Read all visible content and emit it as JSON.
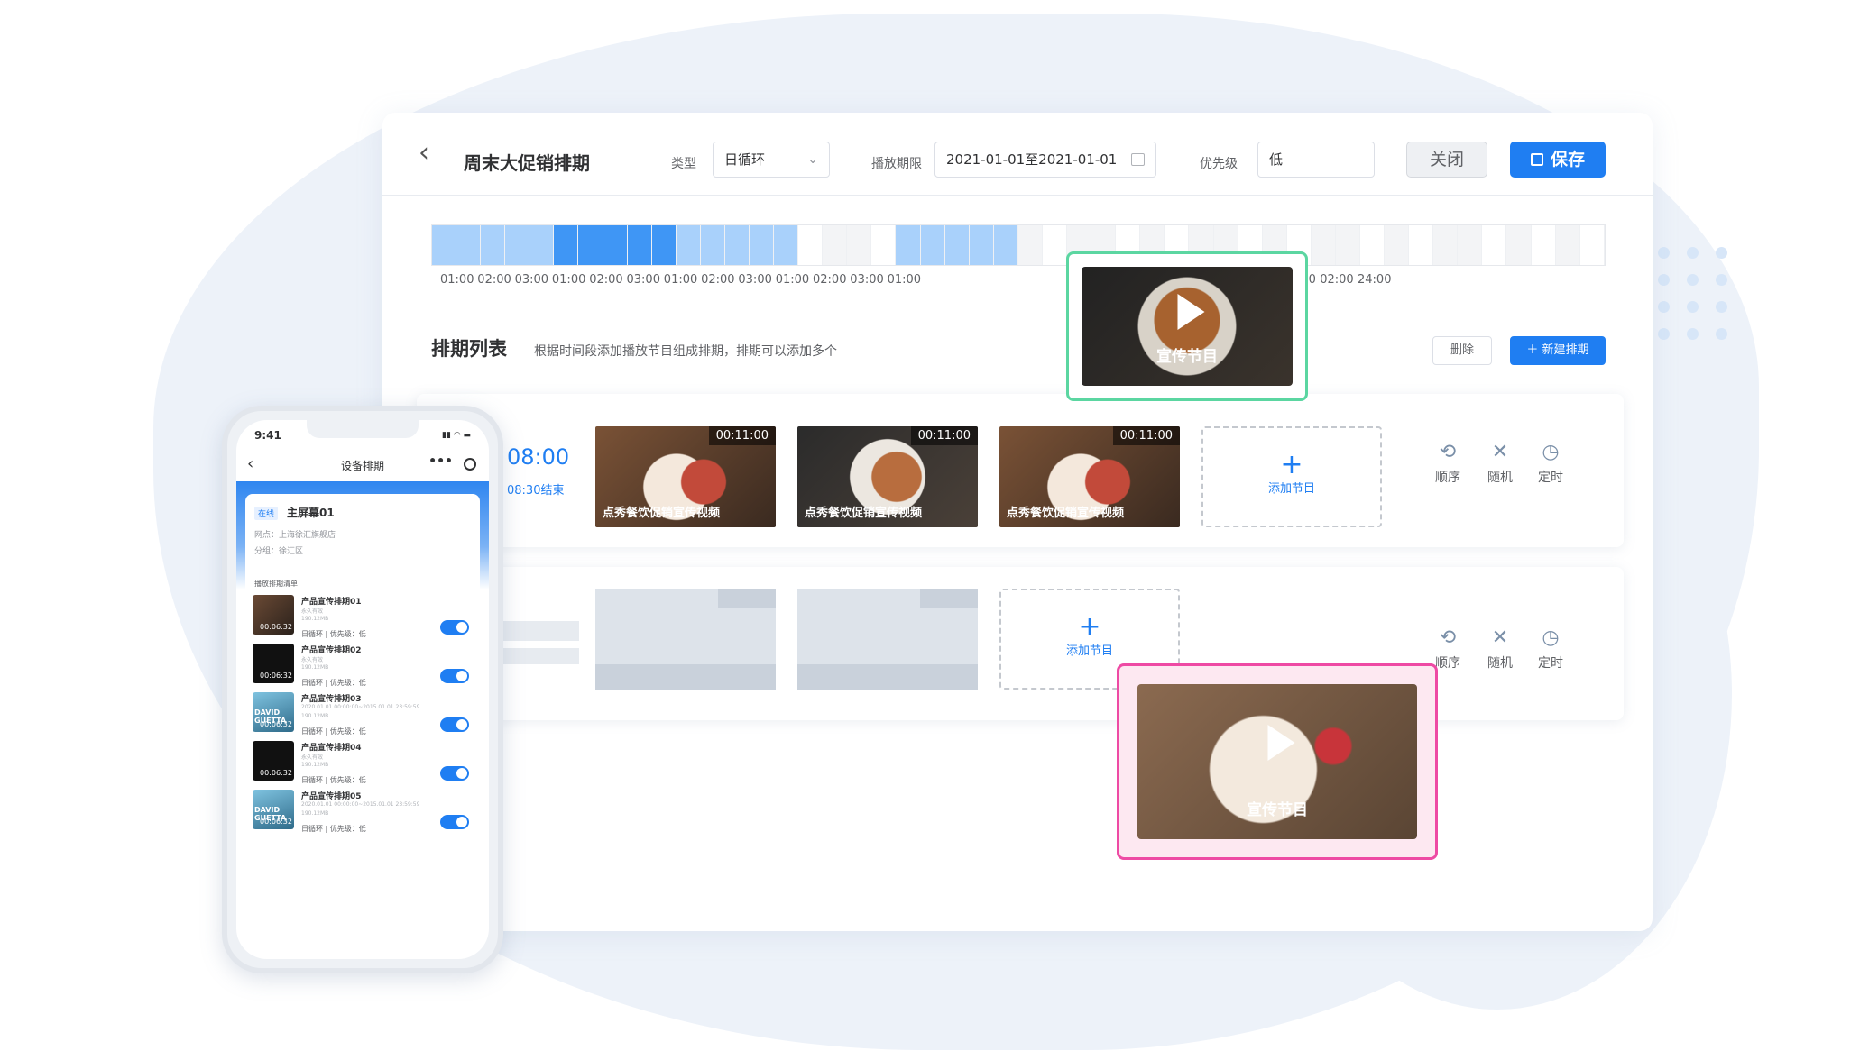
{
  "header": {
    "title": "周末大促销排期",
    "type_label": "类型",
    "type_value": "日循环",
    "period_label": "播放期限",
    "period_value": "2021-01-01至2021-01-01",
    "priority_label": "优先级",
    "priority_value": "低",
    "close_label": "关闭",
    "save_label": "保存"
  },
  "timeline": {
    "ticks": [
      "01:00",
      "02:00",
      "03:00",
      "01:00",
      "02:00",
      "03:00",
      "01:00",
      "02:00",
      "03:00",
      "01:00",
      "02:00",
      "03:00",
      "01:00",
      "01:00",
      "02:00",
      "03:00",
      "01:00",
      "02:00",
      "24:00"
    ],
    "segments": [
      "#a9d1fb",
      "#a9d1fb",
      "#a9d1fb",
      "#a9d1fb",
      "#a9d1fb",
      "#3f96f5",
      "#3f96f5",
      "#3f96f5",
      "#3f96f5",
      "#3f96f5",
      "#a9d1fb",
      "#a9d1fb",
      "#a9d1fb",
      "#a9d1fb",
      "#a9d1fb",
      "#ffffff",
      "#f3f4f6",
      "#f3f4f6",
      "#ffffff",
      "#a9d1fb",
      "#a9d1fb",
      "#a9d1fb",
      "#a9d1fb",
      "#a9d1fb",
      "#f3f4f6",
      "#ffffff",
      "#f3f4f6",
      "#f3f4f6",
      "#ffffff",
      "#f3f4f6",
      "#ffffff",
      "#f3f4f6",
      "#f3f4f6",
      "#ffffff",
      "#f3f4f6",
      "#ffffff",
      "#f3f4f6",
      "#f3f4f6",
      "#ffffff",
      "#f3f4f6",
      "#ffffff",
      "#f3f4f6",
      "#f3f4f6",
      "#ffffff",
      "#f3f4f6",
      "#ffffff",
      "#f3f4f6",
      "#ffffff"
    ]
  },
  "section": {
    "title": "排期列表",
    "description": "根据时间段添加播放节目组成排期，排期可以添加多个",
    "delete_label": "删除",
    "new_label": "＋ 新建排期"
  },
  "schedule1": {
    "start": "08:00",
    "end": "08:30结束",
    "programs": [
      {
        "duration": "00:11:00",
        "caption": "点秀餐饮促销宣传视频"
      },
      {
        "duration": "00:11:00",
        "caption": "点秀餐饮促销宣传视频"
      },
      {
        "duration": "00:11:00",
        "caption": "点秀餐饮促销宣传视频"
      }
    ],
    "add_label": "添加节目"
  },
  "schedule2": {
    "add_label": "添加节目"
  },
  "modes": {
    "order": "顺序",
    "random": "随机",
    "timed": "定时"
  },
  "popups": {
    "caption": "宣传节目"
  },
  "phone": {
    "time": "9:41",
    "nav_title": "设备排期",
    "badge": "在线",
    "device_name": "主屏幕01",
    "site": "网点：上海徐汇旗舰店",
    "group": "分组：徐汇区",
    "list_title": "播放排期清单",
    "items": [
      {
        "name": "产品宣传排期01",
        "sub1": "永久有效",
        "sub2": "190.12MB",
        "meta": "日循环 | 优先级：低",
        "duration": "00:06:32"
      },
      {
        "name": "产品宣传排期02",
        "sub1": "永久有效",
        "sub2": "190.12MB",
        "meta": "日循环 | 优先级：低",
        "duration": "00:06:32"
      },
      {
        "name": "产品宣传排期03",
        "sub1": "2020.01.01 00:00:00~2015.01.01 23:59:59",
        "sub2": "190.12MB",
        "meta": "日循环 | 优先级：低",
        "duration": "00:06:32",
        "overlay": "DAVID GUETTA"
      },
      {
        "name": "产品宣传排期04",
        "sub1": "永久有效",
        "sub2": "190.12MB",
        "meta": "日循环 | 优先级：低",
        "duration": "00:06:32"
      },
      {
        "name": "产品宣传排期05",
        "sub1": "2020.01.01 00:00:00~2015.01.01 23:59:59",
        "sub2": "190.12MB",
        "meta": "日循环 | 优先级：低",
        "duration": "00:06:32",
        "overlay": "DAVID GUETTA"
      }
    ]
  }
}
